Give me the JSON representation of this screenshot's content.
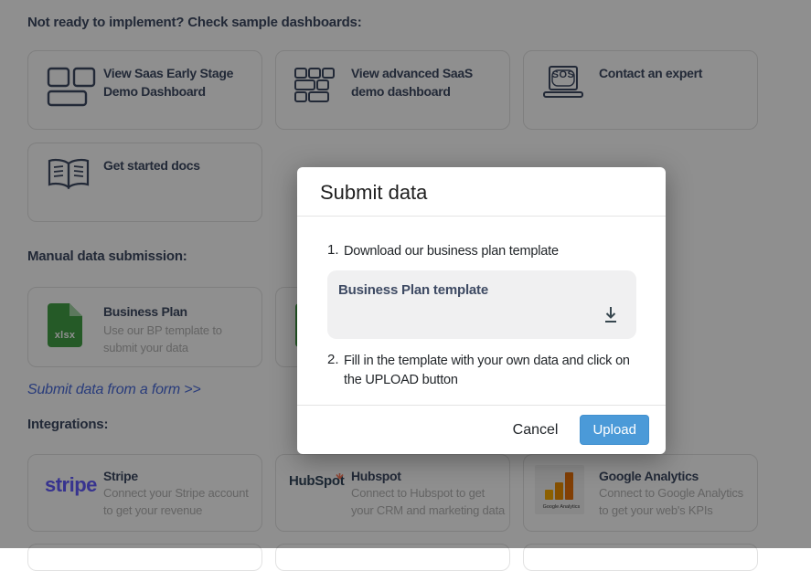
{
  "page": {
    "samples": {
      "heading": "Not ready to implement? Check sample dashboards:",
      "cards": [
        {
          "label": "View Saas Early Stage Demo Dashboard",
          "icon": "dashboard-grid-icon"
        },
        {
          "label": "View advanced SaaS demo dashboard",
          "icon": "dashboard-advanced-grid-icon"
        },
        {
          "label": "Contact an expert",
          "icon": "sos-laptop-icon",
          "icon_text": "SOS"
        },
        {
          "label": "Get started docs",
          "icon": "open-book-icon"
        }
      ]
    },
    "manual": {
      "heading": "Manual data submission:",
      "cards": [
        {
          "title": "Business Plan",
          "description": "Use our BP template to submit your data",
          "icon": "xlsx-file-icon",
          "file_badge": "xlsx"
        }
      ],
      "form_link": "Submit data from a form >>"
    },
    "integrations": {
      "heading": "Integrations:",
      "cards": [
        {
          "title": "Stripe",
          "description": "Connect your Stripe account to get your revenue",
          "logo_text": "stripe",
          "icon": "stripe-logo"
        },
        {
          "title": "Hubspot",
          "description": "Connect to Hubspot to get your CRM and marketing data",
          "logo_parts": {
            "pre": "HubSp",
            "o": "o",
            "post": "t"
          },
          "icon": "hubspot-logo"
        },
        {
          "title": "Google Analytics",
          "description": "Connect to Google Analytics to get your web's KPIs",
          "logo_caption": "Google Analytics",
          "icon": "google-analytics-logo"
        }
      ]
    }
  },
  "modal": {
    "title": "Submit data",
    "step1": {
      "number": "1.",
      "text": "Download our business plan template"
    },
    "download_box": {
      "label": "Business Plan template",
      "icon": "download-icon"
    },
    "step2": {
      "number": "2.",
      "text": "Fill in the template with your own data and click on the UPLOAD button"
    },
    "footer": {
      "cancel_label": "Cancel",
      "upload_label": "Upload"
    }
  },
  "colors": {
    "heading-navy": "#3e4a63",
    "muted-text": "#b3b3b3",
    "link-blue": "#4a6bdc",
    "upload-blue": "#4b9ad8",
    "stripe-purple": "#635bff",
    "hubspot-dark": "#33475b",
    "hubspot-orange": "#ff7a59",
    "xlsx-green": "#43a047",
    "xlsx-green-light": "#a5d6a7",
    "ga-orange": "#e8710a",
    "ga-amber": "#f9ab00",
    "overlay": "rgba(0,0,0,0.44)"
  }
}
